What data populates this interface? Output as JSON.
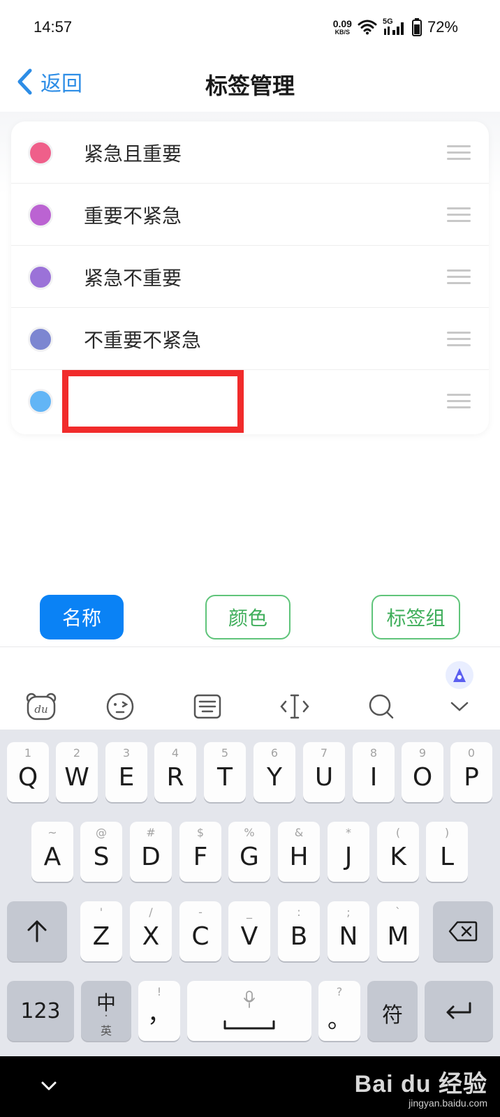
{
  "status_bar": {
    "time": "14:57",
    "network_speed": "0.09",
    "network_speed_unit": "KB/S",
    "signal_type": "5G",
    "battery": "72%"
  },
  "nav": {
    "back_label": "返回",
    "title": "标签管理"
  },
  "tags": [
    {
      "name": "紧急且重要",
      "color": "#ef5f8a"
    },
    {
      "name": "重要不紧急",
      "color": "#bb63d2"
    },
    {
      "name": "紧急不重要",
      "color": "#9b72d8"
    },
    {
      "name": "不重要不紧急",
      "color": "#7c86d1"
    },
    {
      "name": "",
      "color": "#62b5f6"
    }
  ],
  "tabs": {
    "name": "名称",
    "color": "颜色",
    "group": "标签组"
  },
  "ime_toolbar": {
    "items": [
      "du-logo-icon",
      "emoji-icon",
      "keyboard-layout-icon",
      "cursor-icon",
      "search-icon",
      "collapse-chevron-icon"
    ]
  },
  "keyboard": {
    "row1": [
      {
        "main": "Q",
        "hint": "1"
      },
      {
        "main": "W",
        "hint": "2"
      },
      {
        "main": "E",
        "hint": "3"
      },
      {
        "main": "R",
        "hint": "4"
      },
      {
        "main": "T",
        "hint": "5"
      },
      {
        "main": "Y",
        "hint": "6"
      },
      {
        "main": "U",
        "hint": "7"
      },
      {
        "main": "I",
        "hint": "8"
      },
      {
        "main": "O",
        "hint": "9"
      },
      {
        "main": "P",
        "hint": "0"
      }
    ],
    "row2": [
      {
        "main": "A",
        "hint": "~"
      },
      {
        "main": "S",
        "hint": "@"
      },
      {
        "main": "D",
        "hint": "#"
      },
      {
        "main": "F",
        "hint": "$"
      },
      {
        "main": "G",
        "hint": "%"
      },
      {
        "main": "H",
        "hint": "&"
      },
      {
        "main": "J",
        "hint": "*"
      },
      {
        "main": "K",
        "hint": "("
      },
      {
        "main": "L",
        "hint": ")"
      }
    ],
    "row3": [
      {
        "main": "Z",
        "hint": "'"
      },
      {
        "main": "X",
        "hint": "/"
      },
      {
        "main": "C",
        "hint": "-"
      },
      {
        "main": "V",
        "hint": "_"
      },
      {
        "main": "B",
        "hint": ":"
      },
      {
        "main": "N",
        "hint": ";"
      },
      {
        "main": "M",
        "hint": "`"
      }
    ],
    "num_key": "123",
    "lang_key": "中",
    "lang_sub": "英",
    "comma": "，",
    "comma_hint": "!",
    "period": "。",
    "period_hint": "?",
    "symbol_key": "符"
  },
  "watermark": {
    "main": "Bai du 经验",
    "sub": "jingyan.baidu.com"
  }
}
